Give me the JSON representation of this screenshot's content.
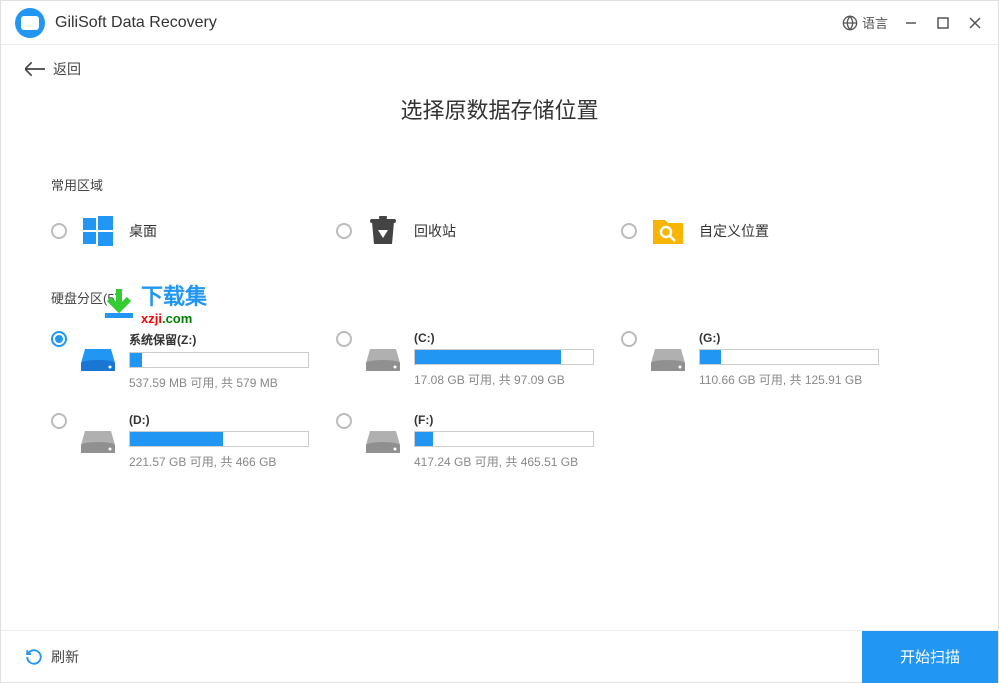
{
  "titlebar": {
    "title": "GiliSoft Data Recovery",
    "language": "语言"
  },
  "back": "返回",
  "heading": "选择原数据存储位置",
  "sections": {
    "common": "常用区域",
    "partitions": "硬盘分区(5)"
  },
  "common_options": {
    "desktop": "桌面",
    "recycle": "回收站",
    "custom": "自定义位置"
  },
  "drives": [
    {
      "label": "系统保留(Z:)",
      "stats": "537.59 MB 可用, 共 579 MB",
      "fill": 7,
      "selected": true,
      "color": "#2196f3"
    },
    {
      "label": "(C:)",
      "stats": "17.08 GB 可用, 共 97.09 GB",
      "fill": 82,
      "selected": false,
      "color": "#888"
    },
    {
      "label": "(G:)",
      "stats": "110.66 GB 可用, 共 125.91 GB",
      "fill": 12,
      "selected": false,
      "color": "#888"
    },
    {
      "label": "(D:)",
      "stats": "221.57 GB 可用, 共 466 GB",
      "fill": 52,
      "selected": false,
      "color": "#888"
    },
    {
      "label": "(F:)",
      "stats": "417.24 GB 可用, 共 465.51 GB",
      "fill": 10,
      "selected": false,
      "color": "#888"
    }
  ],
  "watermark": {
    "cn": "下载集",
    "url_prefix": "xzji",
    "url_suffix": ".com"
  },
  "footer": {
    "refresh": "刷新",
    "scan": "开始扫描"
  }
}
